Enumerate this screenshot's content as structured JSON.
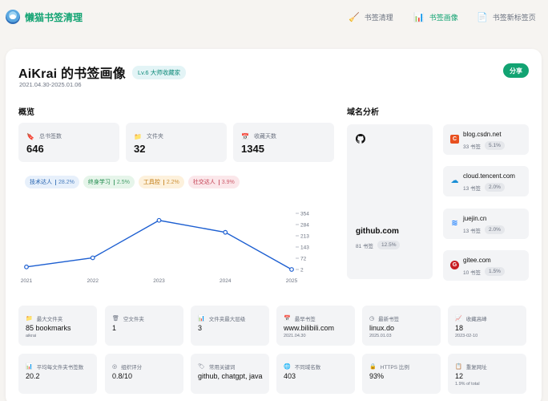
{
  "app": {
    "title": "懒猫书签清理"
  },
  "nav": [
    {
      "label": "书签清理",
      "icon": "broom-icon",
      "glyph": "🧹",
      "active": false
    },
    {
      "label": "书签画像",
      "icon": "bar-chart-icon",
      "glyph": "📊",
      "active": true
    },
    {
      "label": "书签新标签页",
      "icon": "document-icon",
      "glyph": "📄",
      "active": false
    }
  ],
  "profile": {
    "title": "AiKrai 的书签画像",
    "level": "Lv.6 大师收藏家",
    "date_range": "2021.04.30-2025.01.06",
    "share_label": "分享"
  },
  "overview": {
    "title": "概览",
    "stats": [
      {
        "label": "总书签数",
        "value": "646",
        "glyph": "🔖",
        "icon": "bookmark-icon"
      },
      {
        "label": "文件夹",
        "value": "32",
        "glyph": "📁",
        "icon": "folder-icon"
      },
      {
        "label": "收藏天数",
        "value": "1345",
        "glyph": "📅",
        "icon": "calendar-icon"
      }
    ],
    "tags": [
      {
        "label": "技术达人",
        "pct": "28.2%"
      },
      {
        "label": "终身学习",
        "pct": "2.5%"
      },
      {
        "label": "工具控",
        "pct": "2.2%"
      },
      {
        "label": "社交达人",
        "pct": "3.9%"
      }
    ]
  },
  "chart_data": {
    "type": "line",
    "categories": [
      "2021",
      "2022",
      "2023",
      "2024",
      "2025"
    ],
    "series": [
      {
        "values": [
          18,
          75,
          310,
          235,
          2
        ]
      }
    ],
    "yticks": [
      "354",
      "284",
      "213",
      "143",
      "72",
      "2"
    ],
    "ylim": [
      2,
      354
    ],
    "color": "#1d5fd1",
    "grid": false
  },
  "domains": {
    "title": "域名分析",
    "main": {
      "name": "github.com",
      "count": "81 书签",
      "pct": "12.5%",
      "icon": "github-icon"
    },
    "others": [
      {
        "name": "blog.csdn.net",
        "count": "33 书签",
        "pct": "5.1%",
        "glyph": "C",
        "color": "#e8501f",
        "icon": "csdn-icon"
      },
      {
        "name": "cloud.tencent.com",
        "count": "13 书签",
        "pct": "2.0%",
        "glyph": "☁",
        "color": "#ffffff",
        "icon": "tencent-cloud-icon"
      },
      {
        "name": "juejin.cn",
        "count": "13 书签",
        "pct": "2.0%",
        "glyph": "≋",
        "color": "#ffffff",
        "icon": "juejin-icon"
      },
      {
        "name": "gitee.com",
        "count": "10 书签",
        "pct": "1.5%",
        "glyph": "G",
        "color": "#c71d23",
        "icon": "gitee-icon"
      }
    ]
  },
  "metrics": [
    {
      "label": "最大文件夹",
      "value": "85 bookmarks",
      "sub": "aikrai",
      "glyph": "📁",
      "icon": "folder-icon"
    },
    {
      "label": "空文件夹",
      "value": "1",
      "sub": "",
      "glyph": "🗑",
      "icon": "trash-icon"
    },
    {
      "label": "文件夹最大层级",
      "value": "3",
      "sub": "",
      "glyph": "📊",
      "icon": "layers-icon"
    },
    {
      "label": "最早书签",
      "value": "www.bilibili.com",
      "sub": "2021.04.30",
      "glyph": "📅",
      "icon": "calendar-icon"
    },
    {
      "label": "最新书签",
      "value": "linux.do",
      "sub": "2025.01.03",
      "glyph": "◷",
      "icon": "clock-icon"
    },
    {
      "label": "收藏高峰",
      "value": "18",
      "sub": "2023-02-10",
      "glyph": "📈",
      "icon": "trend-icon"
    },
    {
      "label": "平均每文件夹书签数",
      "value": "20.2",
      "sub": "",
      "glyph": "📊",
      "icon": "bar-chart-icon"
    },
    {
      "label": "组织评分",
      "value": "0.8/10",
      "sub": "",
      "glyph": "◎",
      "icon": "target-icon"
    },
    {
      "label": "常用关键词",
      "value": "github, chatgpt, java",
      "sub": "",
      "glyph": "🏷",
      "icon": "tag-icon"
    },
    {
      "label": "不同域名数",
      "value": "403",
      "sub": "",
      "glyph": "🌐",
      "icon": "globe-icon"
    },
    {
      "label": "HTTPS 比例",
      "value": "93%",
      "sub": "",
      "glyph": "🔒",
      "icon": "lock-icon"
    },
    {
      "label": "重复网址",
      "value": "12",
      "sub": "1.9% of total",
      "glyph": "📋",
      "icon": "duplicate-icon"
    }
  ]
}
